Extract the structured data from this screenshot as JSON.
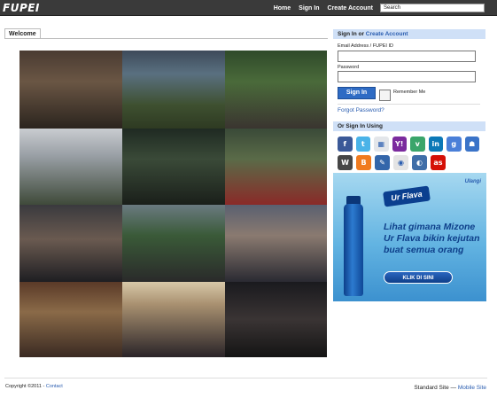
{
  "header": {
    "logo": "FUPEI",
    "nav": [
      "Home",
      "Sign In",
      "Create Account"
    ],
    "search_placeholder": "Search"
  },
  "main": {
    "tab_label": "Welcome"
  },
  "signin": {
    "heading": "Sign In or",
    "heading_link": "Create Account",
    "email_label": "Email Address / FUPEI ID",
    "password_label": "Password",
    "button": "Sign In",
    "remember": "Remember Me",
    "forgot": "Forgot Password?"
  },
  "social": {
    "heading": "Or Sign In Using",
    "icons": [
      {
        "name": "facebook-icon",
        "glyph": "f",
        "color": "#3b5998"
      },
      {
        "name": "twitter-icon",
        "glyph": "t",
        "color": "#4ab3e8"
      },
      {
        "name": "windows-live-icon",
        "glyph": "▦",
        "color": "#e3e6ea"
      },
      {
        "name": "yahoo-icon",
        "glyph": "Y!",
        "color": "#7b2b9e"
      },
      {
        "name": "vine-icon",
        "glyph": "v",
        "color": "#3aa56a"
      },
      {
        "name": "linkedin-icon",
        "glyph": "in",
        "color": "#0b78b7"
      },
      {
        "name": "google-icon",
        "glyph": "g",
        "color": "#4a7fd8"
      },
      {
        "name": "myspace-icon",
        "glyph": "☗",
        "color": "#3a73c8"
      },
      {
        "name": "wordpress-icon",
        "glyph": "W",
        "color": "#464646"
      },
      {
        "name": "blogger-icon",
        "glyph": "B",
        "color": "#f07b1f"
      },
      {
        "name": "livejournal-icon",
        "glyph": "✎",
        "color": "#3366aa"
      },
      {
        "name": "aol-icon",
        "glyph": "◉",
        "color": "#e4e4e4"
      },
      {
        "name": "openid-icon",
        "glyph": "◐",
        "color": "#3f6ea8"
      },
      {
        "name": "lastfm-icon",
        "glyph": "as",
        "color": "#d51007"
      }
    ]
  },
  "ad": {
    "brand": "Ulangi",
    "logo": "Ur Flava",
    "text": "Lihat gimana Mizone Ur Flava bikin kejutan buat semua orang",
    "button": "KLIK DI SINI"
  },
  "footer": {
    "copyright": "Copyright ©2011 -",
    "contact": "Contact",
    "site_standard": "Standard Site —",
    "site_mobile": "Mobile Site"
  }
}
